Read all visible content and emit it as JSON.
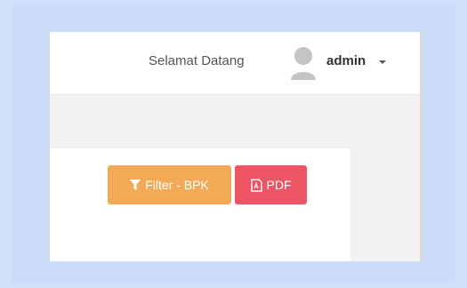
{
  "header": {
    "greeting": "Selamat Datang",
    "username": "admin",
    "avatar_icon": "user-avatar-icon",
    "dropdown_icon": "caret-down-icon"
  },
  "toolbar": {
    "filter_label": "Filter - BPK",
    "filter_icon": "filter-icon",
    "pdf_label": "PDF",
    "pdf_icon": "file-pdf-icon"
  },
  "colors": {
    "filter_button": "#f3aa56",
    "pdf_button": "#ed5565",
    "page_background": "#f2f2f2",
    "outer_background": "#cfe0fa"
  }
}
